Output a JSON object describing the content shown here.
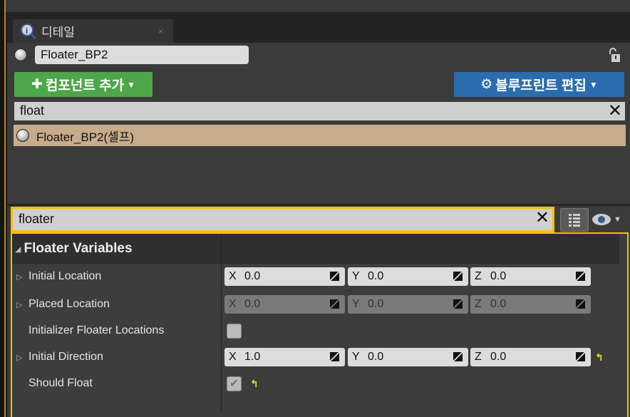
{
  "tab": {
    "title": "디테일",
    "close": "×",
    "icon": "details-magnifier-icon"
  },
  "actor": {
    "name": "Floater_BP2",
    "lock_icon": "unlock-icon"
  },
  "buttons": {
    "add_component": "컴포넌트 추가",
    "edit_blueprint": "블루프린트 편집",
    "add_color": "#4ea64a",
    "edit_color": "#2b6cae"
  },
  "component_search": {
    "value": "float"
  },
  "tree": {
    "items": [
      {
        "label": "Floater_BP2(셀프)",
        "selected": true
      }
    ]
  },
  "details_search": {
    "value": "floater"
  },
  "category": {
    "title": "Floater Variables",
    "expanded": true
  },
  "properties": [
    {
      "label": "Initial Location",
      "type": "vector",
      "expandable": true,
      "enabled": true,
      "x": "0.0",
      "y": "0.0",
      "z": "0.0",
      "reset": false
    },
    {
      "label": "Placed Location",
      "type": "vector",
      "expandable": true,
      "enabled": false,
      "x": "0.0",
      "y": "0.0",
      "z": "0.0",
      "reset": false
    },
    {
      "label": "Initializer Floater Locations",
      "type": "bool",
      "checked": false,
      "reset": false
    },
    {
      "label": "Initial Direction",
      "type": "vector",
      "expandable": true,
      "enabled": true,
      "x": "1.0",
      "y": "0.0",
      "z": "0.0",
      "reset": true
    },
    {
      "label": "Should Float",
      "type": "bool",
      "checked": true,
      "reset": true
    }
  ],
  "axes": {
    "x": "X",
    "y": "Y",
    "z": "Z"
  },
  "accent": "#f6c000"
}
